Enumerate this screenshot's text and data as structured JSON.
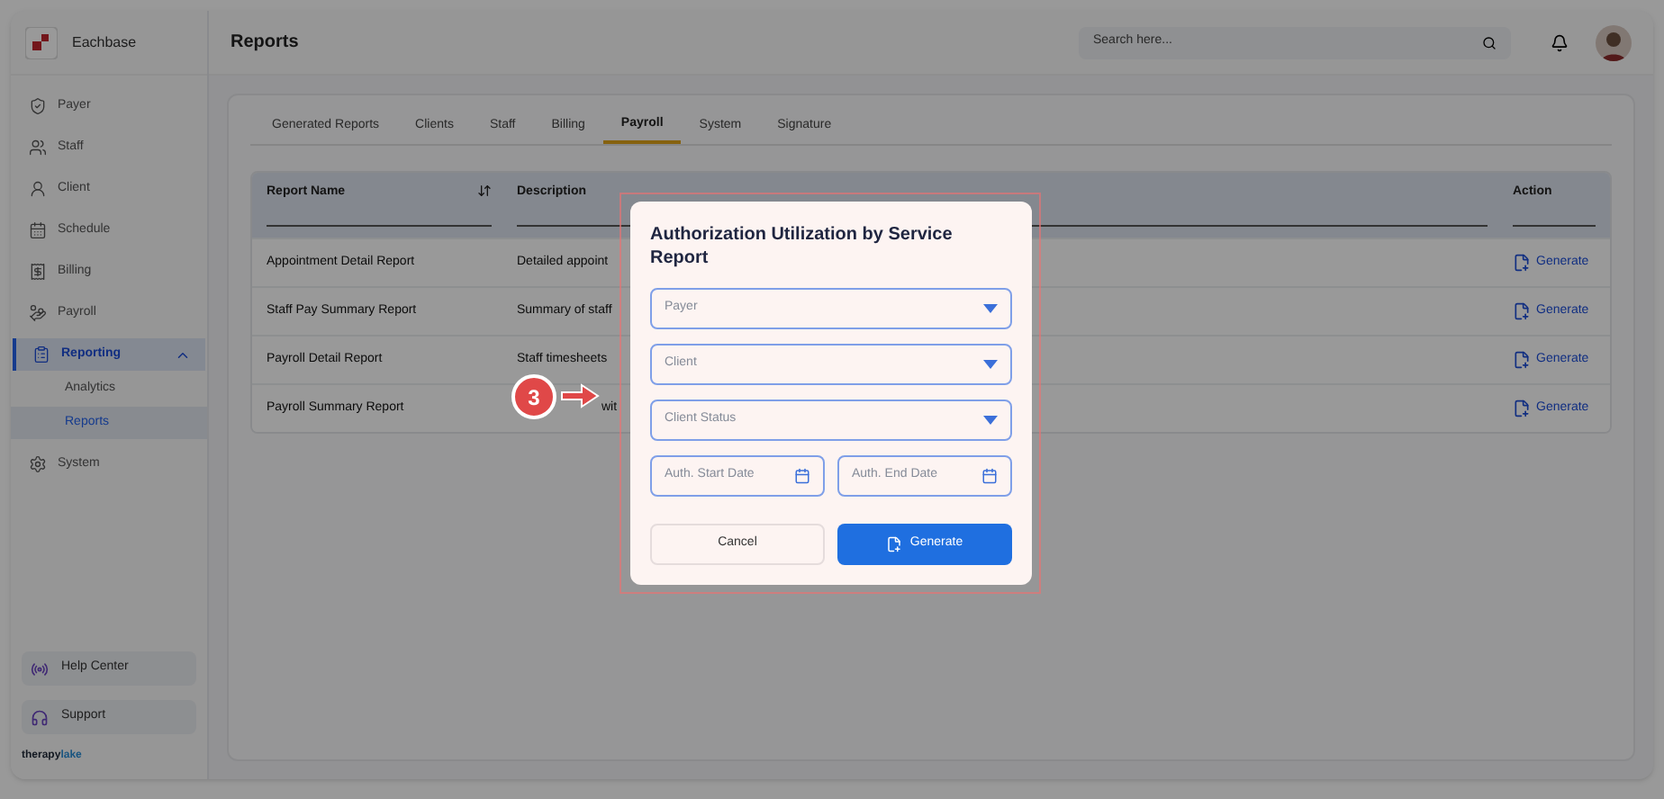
{
  "brand": {
    "name": "Eachbase"
  },
  "sidebar": {
    "items": [
      {
        "label": "Payer",
        "selected": false
      },
      {
        "label": "Staff",
        "selected": false
      },
      {
        "label": "Client",
        "selected": false
      },
      {
        "label": "Schedule",
        "selected": false
      },
      {
        "label": "Billing",
        "selected": false
      },
      {
        "label": "Payroll",
        "selected": false
      },
      {
        "label": "Reporting",
        "selected": true,
        "expanded": true,
        "children": [
          {
            "label": "Analytics",
            "selected": false
          },
          {
            "label": "Reports",
            "selected": true
          }
        ]
      },
      {
        "label": "System",
        "selected": false
      }
    ],
    "bottom": [
      {
        "label": "Help Center"
      },
      {
        "label": "Support"
      }
    ],
    "footer_brand": [
      "therapy",
      "lake"
    ]
  },
  "header": {
    "title": "Reports",
    "search": {
      "placeholder": "Search here..."
    }
  },
  "tabs": [
    {
      "label": "Generated Reports",
      "selected": false
    },
    {
      "label": "Clients",
      "selected": false
    },
    {
      "label": "Staff",
      "selected": false
    },
    {
      "label": "Billing",
      "selected": false
    },
    {
      "label": "Payroll",
      "selected": true
    },
    {
      "label": "System",
      "selected": false
    },
    {
      "label": "Signature",
      "selected": false
    }
  ],
  "table": {
    "columns": [
      "Report Name",
      "Description",
      "Action"
    ],
    "rows": [
      {
        "name": "Appointment Detail Report",
        "description": "Detailed appoint",
        "action": "Generate"
      },
      {
        "name": "Staff Pay Summary Report",
        "description": "Summary of staff",
        "action": "Generate"
      },
      {
        "name": "Payroll Detail Report",
        "description": "Staff timesheets",
        "action": "Generate"
      },
      {
        "name": "Payroll Summary Report",
        "description": "wit",
        "action": "Generate"
      }
    ]
  },
  "dialog": {
    "title": "Authorization Utilization by Service Report",
    "fields": [
      {
        "kind": "select",
        "placeholder": "Payer"
      },
      {
        "kind": "select",
        "placeholder": "Client"
      },
      {
        "kind": "select",
        "placeholder": "Client Status"
      },
      {
        "kind": "date",
        "placeholder": "Auth. Start Date"
      },
      {
        "kind": "date",
        "placeholder": "Auth. End Date"
      }
    ],
    "buttons": [
      {
        "label": "Cancel",
        "kind": "secondary"
      },
      {
        "label": "Generate",
        "kind": "primary"
      }
    ]
  },
  "step_marker": {
    "label": "3"
  }
}
